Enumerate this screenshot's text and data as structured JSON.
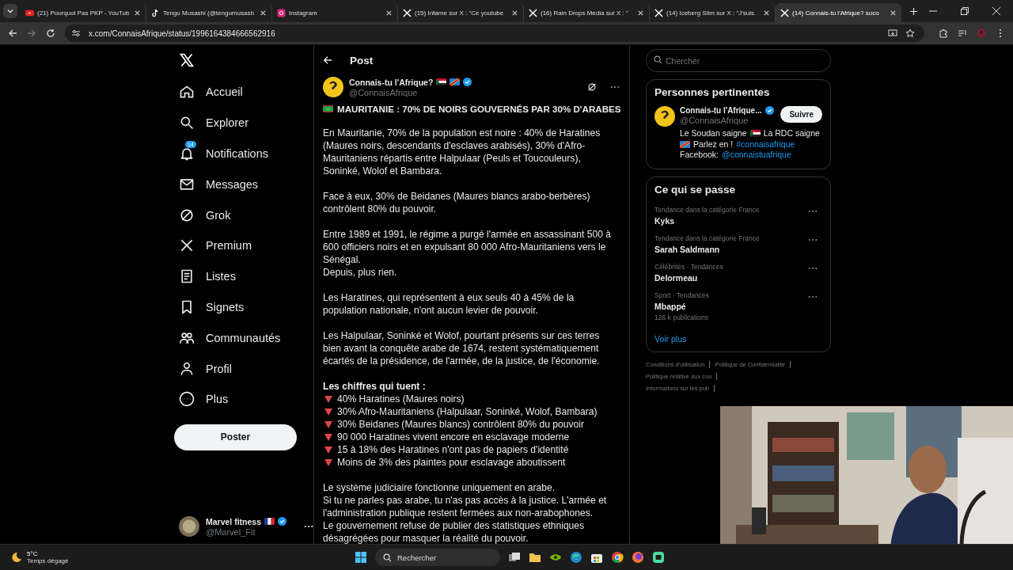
{
  "browser": {
    "tabs": [
      {
        "title": "(21) Pourquoi Pas PKP - YouTub",
        "selected": false
      },
      {
        "title": "Tengu Musashi (@tengumusash",
        "selected": false
      },
      {
        "title": "Instagram",
        "selected": false
      },
      {
        "title": "(15) Infame sur X : \"Ce youtube",
        "selected": false
      },
      {
        "title": "(16) Rain Drops Media sur X : \"",
        "selected": false
      },
      {
        "title": "(14) Iceberg Slim sur X : \"J'suis",
        "selected": false
      },
      {
        "title": "(14) Connais-tu l'Afrique? soco",
        "selected": true
      }
    ],
    "address": "x.com/ConnaisAfrique/status/1996164384666562916"
  },
  "sidebar": {
    "items": [
      {
        "label": "Accueil"
      },
      {
        "label": "Explorer"
      },
      {
        "label": "Notifications",
        "badge": "14"
      },
      {
        "label": "Messages"
      },
      {
        "label": "Grok"
      },
      {
        "label": "Premium"
      },
      {
        "label": "Listes"
      },
      {
        "label": "Signets"
      },
      {
        "label": "Communautés"
      },
      {
        "label": "Profil"
      },
      {
        "label": "Plus"
      }
    ],
    "post_button": "Poster",
    "account": {
      "name": "Marvel fitness",
      "handle": "@Marvel_Fit"
    }
  },
  "post": {
    "header": "Post",
    "author": "Connais-tu l'Afrique?",
    "handle": "@ConnaisAfrique",
    "title": "MAURITANIE : 70% DE NOIRS GOUVERNÉS PAR 30% D'ARABES",
    "blocks": [
      {
        "kind": "paragraph",
        "lines": [
          "En Mauritanie, 70% de la population est noire : 40% de Haratines (Maures noirs, descendants d'esclaves arabisés), 30% d'Afro-Mauritaniens répartis entre Halpulaar (Peuls et Toucouleurs), Soninké, Wolof et Bambara."
        ]
      },
      {
        "kind": "paragraph",
        "lines": [
          "Face à eux, 30% de Beidanes (Maures blancs arabo-berbères) contrôlent 80% du pouvoir."
        ]
      },
      {
        "kind": "paragraph",
        "lines": [
          "Entre 1989 et 1991, le régime a purgé l'armée en assassinant 500 à 600 officiers noirs et en expulsant 80 000 Afro-Mauritaniens vers le Sénégal.",
          "Depuis, plus rien."
        ]
      },
      {
        "kind": "paragraph",
        "lines": [
          "Les Haratines, qui représentent à eux seuls 40 à 45% de la population nationale, n'ont aucun levier de pouvoir."
        ]
      },
      {
        "kind": "paragraph",
        "lines": [
          "Les Halpulaar, Soninké et Wolof, pourtant présents sur ces terres bien avant la conquête arabe de 1674, restent systématiquement écartés de la présidence, de l'armée, de la justice, de l'économie."
        ]
      },
      {
        "kind": "list",
        "heading": "Les chiffres qui tuent :",
        "items": [
          "40% Haratines (Maures noirs)",
          "30% Afro-Mauritaniens (Halpulaar, Soninké, Wolof, Bambara)",
          "30% Beidanes (Maures blancs) contrôlent 80% du pouvoir",
          "90 000 Haratines vivent encore en esclavage moderne",
          "15 à 18% des Haratines n'ont pas de papiers d'identité",
          "Moins de 3% des plaintes pour esclavage aboutissent"
        ]
      },
      {
        "kind": "paragraph",
        "lines": [
          "Le système judiciaire fonctionne uniquement en arabe.",
          "Si tu ne parles pas arabe, tu n'as pas accès à la justice. L'armée et l'administration publique restent fermées aux non-arabophones.",
          "Le gouvernement refuse de publier des statistiques ethniques désagrégées pour masquer la réalité du pouvoir."
        ]
      }
    ]
  },
  "right": {
    "search": {
      "placeholder": "Chercher"
    },
    "people": {
      "title": "Personnes pertinentes",
      "name": "Connais-tu l'Afrique...",
      "handle": "@ConnaisAfrique",
      "follow": "Suivre",
      "bio": [
        [
          {
            "kind": "text",
            "text": "Le Soudan saigne"
          },
          {
            "kind": "flag"
          },
          {
            "kind": "text",
            "text": "La RDC saigne"
          }
        ],
        [
          {
            "kind": "flag"
          },
          {
            "kind": "text",
            "text": "Parlez en !"
          },
          {
            "kind": "link",
            "text": "#connaisafrique"
          }
        ],
        [
          {
            "kind": "text",
            "text": "Facebook:"
          },
          {
            "kind": "link",
            "text": "@connaistuafrique"
          }
        ]
      ]
    },
    "trends": {
      "title": "Ce qui se passe",
      "items": [
        {
          "category": "Tendance dans la catégorie France",
          "name": "Kyks"
        },
        {
          "category": "Tendance dans la catégorie France",
          "name": "Sarah Saldmann"
        },
        {
          "category": "Célébrités · Tendances",
          "name": "Delormeau"
        },
        {
          "category": "Sport · Tendances",
          "name": "Mbappé",
          "count": "126 k publications"
        }
      ],
      "more": "Voir plus"
    },
    "footer": [
      [
        "Conditions d'utilisation",
        "Politique de Confidentialité"
      ],
      [
        "Politique relative aux coo"
      ],
      [
        "Informations sur les pub"
      ]
    ]
  },
  "taskbar": {
    "temperature": "5°C",
    "weather": "Temps dégagé",
    "search": {
      "placeholder": "Rechercher"
    }
  }
}
